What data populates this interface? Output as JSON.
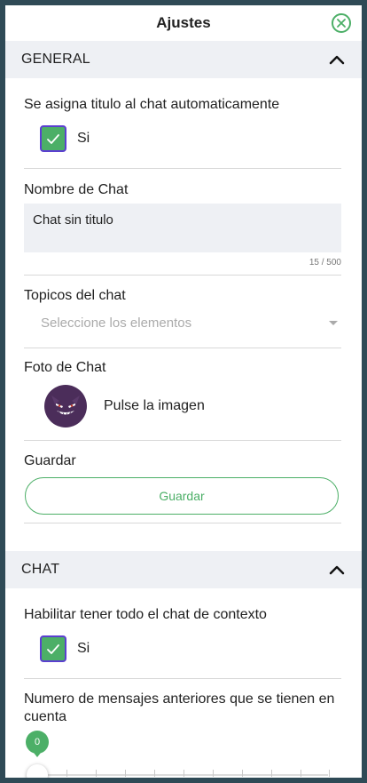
{
  "header": {
    "title": "Ajustes",
    "close_icon": "close-circle-icon"
  },
  "general": {
    "title": "GENERAL",
    "auto_title": {
      "label": "Se asigna titulo al chat automaticamente",
      "checkbox_label": "Si",
      "checked": true
    },
    "chat_name": {
      "label": "Nombre de Chat",
      "value": "Chat sin titulo",
      "counter": "15 / 500"
    },
    "topics": {
      "label": "Topicos del chat",
      "placeholder": "Seleccione los elementos"
    },
    "photo": {
      "label": "Foto de Chat",
      "hint": "Pulse la imagen",
      "avatar_icon": "gengar-avatar-icon"
    },
    "save": {
      "label": "Guardar",
      "button": "Guardar"
    }
  },
  "chat": {
    "title": "CHAT",
    "full_context": {
      "label": "Habilitar tener todo el chat de contexto",
      "checkbox_label": "Si",
      "checked": true
    },
    "previous_messages": {
      "label": "Numero de mensajes anteriores que se tienen en cuenta",
      "value": "0"
    }
  },
  "colors": {
    "accent": "#4caf67",
    "checkbox_border": "#5b3fd0",
    "section_bg": "#eef0f4",
    "frame": "#2f4a56"
  }
}
